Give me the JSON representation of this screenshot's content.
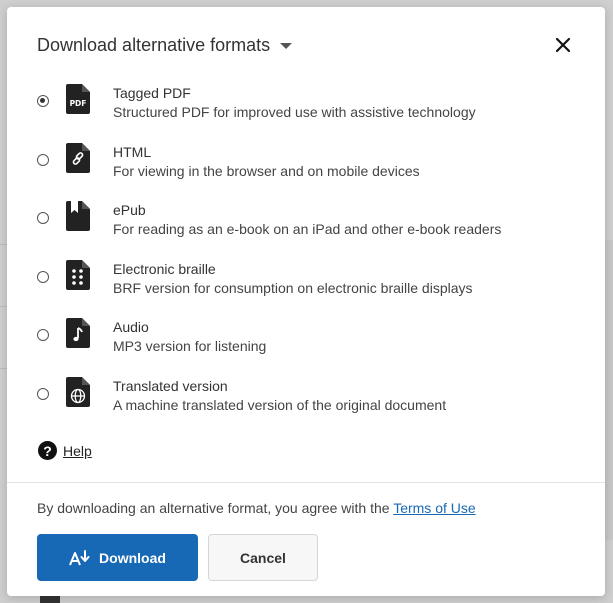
{
  "dialog": {
    "title": "Download alternative formats",
    "close_icon": "close-icon",
    "options": [
      {
        "title": "Tagged PDF",
        "description": "Structured PDF for improved use with assistive technology",
        "icon": "pdf-file-icon",
        "icon_label": "PDF",
        "selected": true
      },
      {
        "title": "HTML",
        "description": "For viewing in the browser and on mobile devices",
        "icon": "link-file-icon",
        "selected": false
      },
      {
        "title": "ePub",
        "description": "For reading as an e-book on an iPad and other e-book readers",
        "icon": "bookmark-file-icon",
        "selected": false
      },
      {
        "title": "Electronic braille",
        "description": "BRF version for consumption on electronic braille displays",
        "icon": "braille-file-icon",
        "selected": false
      },
      {
        "title": "Audio",
        "description": "MP3 version for listening",
        "icon": "music-file-icon",
        "selected": false
      },
      {
        "title": "Translated version",
        "description": "A machine translated version of the original document",
        "icon": "globe-file-icon",
        "selected": false
      }
    ],
    "help": {
      "icon": "question-icon",
      "label": "Help"
    },
    "terms": {
      "text": "By downloading an alternative format, you agree with the ",
      "link": "Terms of Use"
    },
    "buttons": {
      "download": "Download",
      "cancel": "Cancel"
    }
  },
  "colors": {
    "primary": "#1769b5",
    "text": "#333333",
    "icon": "#222222"
  }
}
